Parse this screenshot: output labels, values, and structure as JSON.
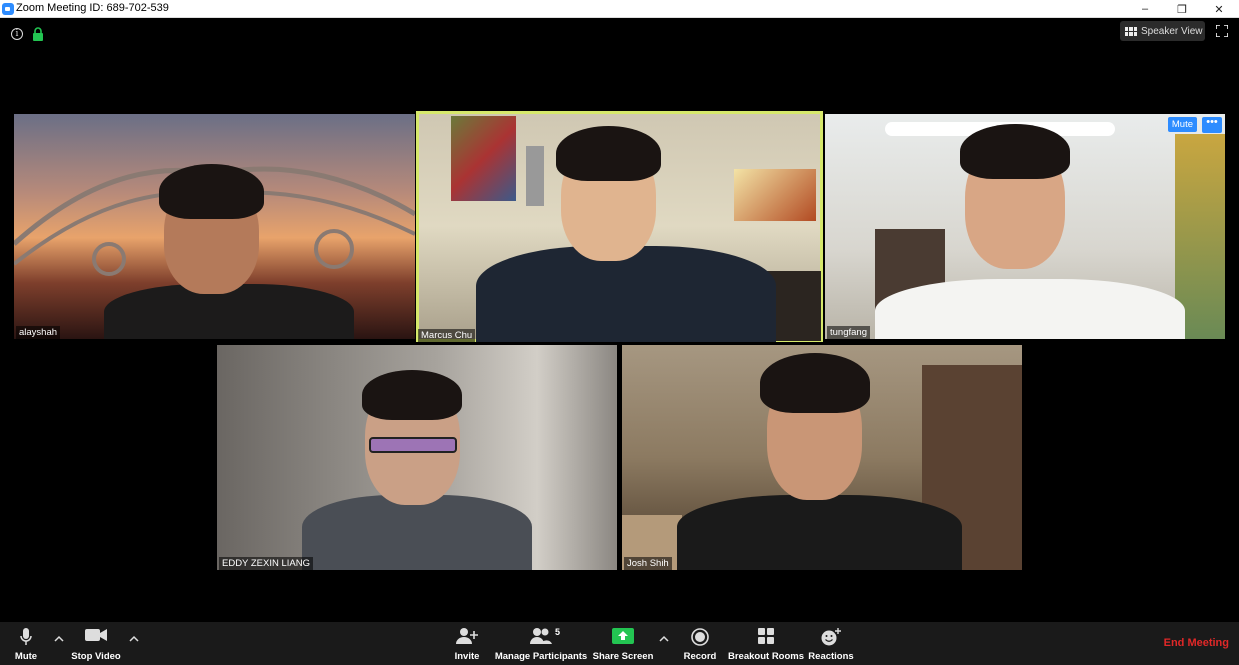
{
  "window": {
    "title": "Zoom Meeting ID: 689-702-539",
    "minimize": "–",
    "restore": "❐",
    "close": "✕"
  },
  "top_controls": {
    "info_glyph": "i",
    "speaker_view_label": "Speaker View"
  },
  "participants": [
    {
      "name": "alayshah",
      "active_speaker": false
    },
    {
      "name": "Marcus Chu",
      "active_speaker": true
    },
    {
      "name": "tungfang",
      "active_speaker": false,
      "hover_mute_label": "Mute",
      "hover_more_label": "•••"
    },
    {
      "name": "EDDY ZEXIN LIANG",
      "active_speaker": false
    },
    {
      "name": "Josh Shih",
      "active_speaker": false
    }
  ],
  "toolbar": {
    "mute_label": "Mute",
    "stop_video_label": "Stop Video",
    "invite_label": "Invite",
    "manage_participants_label": "Manage Participants",
    "participant_count": "5",
    "share_screen_label": "Share Screen",
    "record_label": "Record",
    "breakout_rooms_label": "Breakout Rooms",
    "reactions_label": "Reactions",
    "end_meeting_label": "End Meeting"
  },
  "colors": {
    "accent_blue": "#2d8cff",
    "share_green": "#23c552",
    "end_red": "#e02828",
    "active_border": "#d6e86b"
  }
}
